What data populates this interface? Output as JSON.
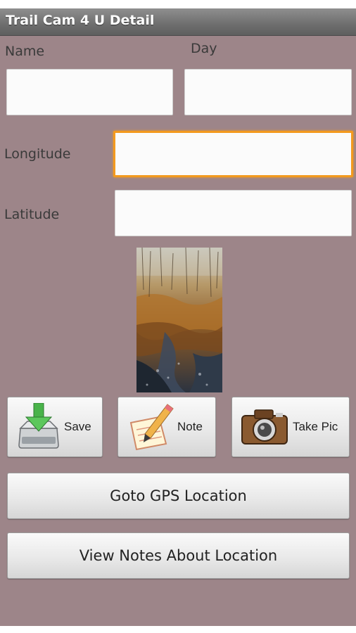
{
  "titlebar": {
    "title": "Trail Cam 4 U Detail"
  },
  "form": {
    "name_label": "Name",
    "day_label": "Day",
    "longitude_label": "Longitude",
    "latitude_label": "Latitude",
    "name_value": "",
    "day_value": "",
    "longitude_value": "",
    "latitude_value": ""
  },
  "photo": {
    "icon": "trail-photo"
  },
  "actions": {
    "save_label": "Save",
    "note_label": "Note",
    "take_pic_label": "Take Pic",
    "goto_gps_label": "Goto GPS Location",
    "view_notes_label": "View Notes About Location"
  },
  "colors": {
    "background": "#9d8589",
    "focus": "#f39a1e"
  }
}
